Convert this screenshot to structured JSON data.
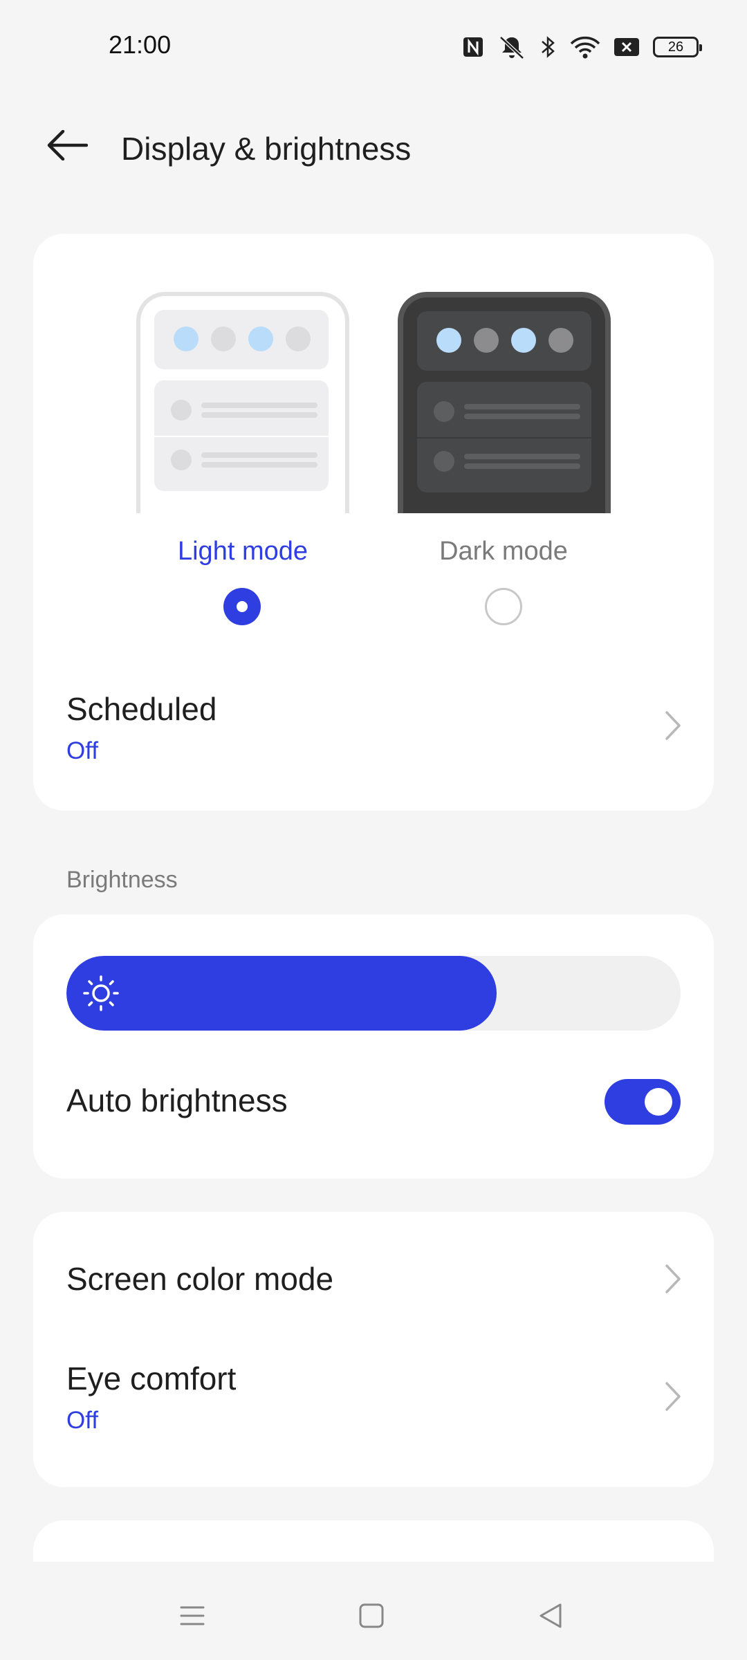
{
  "status_bar": {
    "time": "21:00",
    "battery": "26",
    "icons": [
      "nfc-icon",
      "mute-icon",
      "bluetooth-icon",
      "wifi-icon",
      "no-sim-icon",
      "battery-icon"
    ]
  },
  "header": {
    "back_icon": "arrow-left-icon",
    "title": "Display & brightness"
  },
  "theme": {
    "light_label": "Light mode",
    "dark_label": "Dark mode",
    "selected": "light",
    "scheduled_title": "Scheduled",
    "scheduled_value": "Off"
  },
  "brightness": {
    "section_label": "Brightness",
    "level_percent": 70,
    "auto_title": "Auto brightness",
    "auto_enabled": true
  },
  "display": {
    "screen_color_title": "Screen color mode",
    "eye_comfort_title": "Eye comfort",
    "eye_comfort_value": "Off"
  },
  "colors": {
    "accent": "#2e3ee0",
    "background": "#f5f5f5",
    "card": "#ffffff",
    "preview_dot_blue": "#b9dcfb",
    "preview_dot_gray_light": "#dcdcde",
    "preview_dot_gray_dark": "#8c8c8e"
  },
  "nav_bar": [
    "menu-icon",
    "home-icon",
    "back-icon"
  ]
}
